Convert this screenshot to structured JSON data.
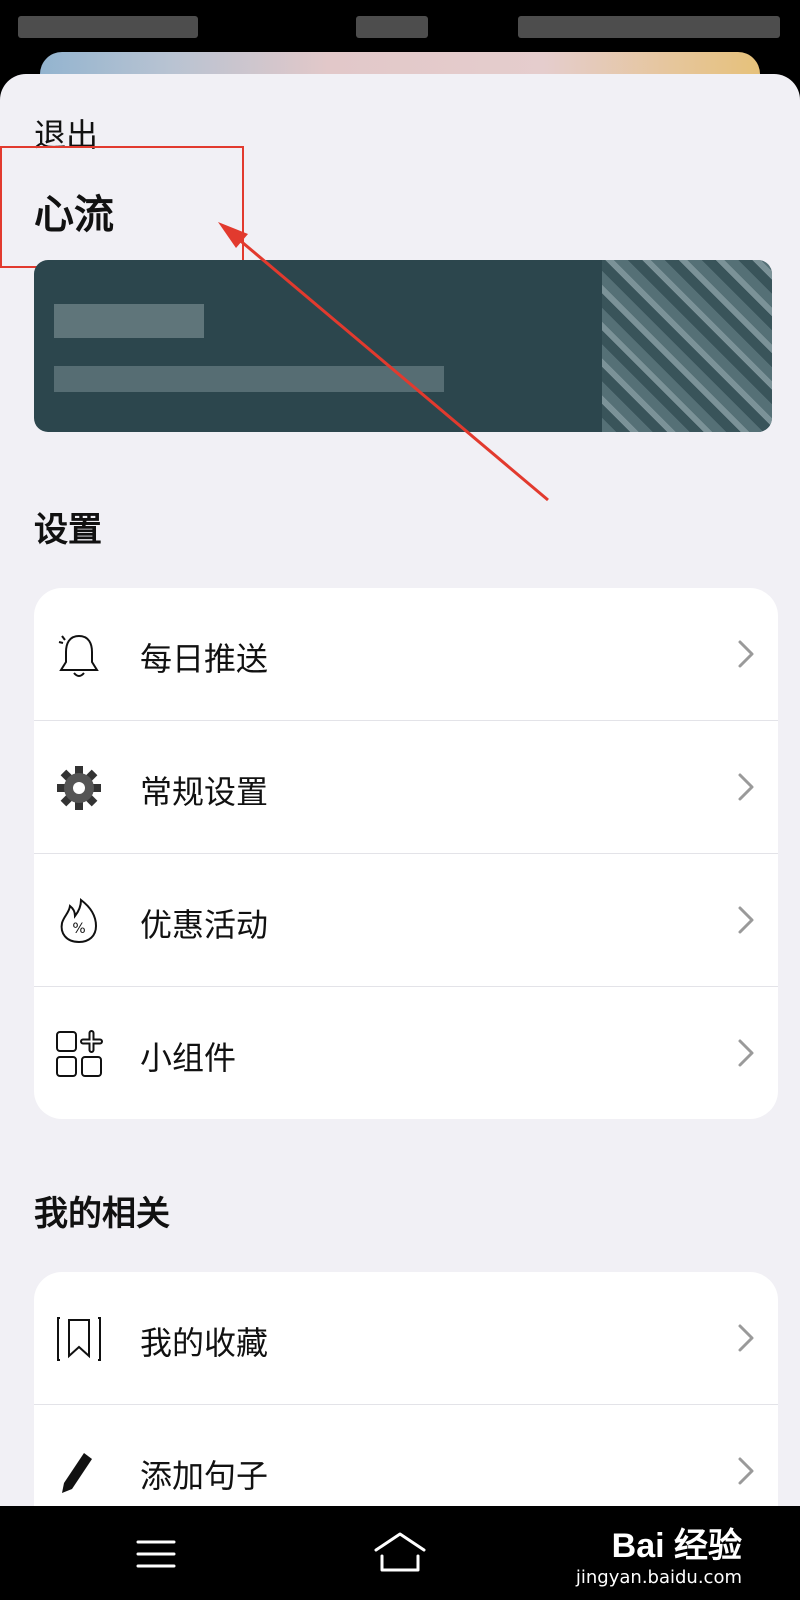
{
  "header": {
    "logout_label": "退出",
    "app_name": "心流"
  },
  "settings": {
    "title": "设置",
    "items": [
      {
        "label": "每日推送",
        "icon": "bell-icon"
      },
      {
        "label": "常规设置",
        "icon": "gear-icon"
      },
      {
        "label": "优惠活动",
        "icon": "discount-fire-icon"
      },
      {
        "label": "小组件",
        "icon": "widgets-icon"
      }
    ]
  },
  "related": {
    "title": "我的相关",
    "items": [
      {
        "label": "我的收藏",
        "icon": "bookmark-icon"
      },
      {
        "label": "添加句子",
        "icon": "pen-icon"
      }
    ]
  },
  "watermark": {
    "brand": "Bai 经验",
    "url": "jingyan.baidu.com"
  },
  "colors": {
    "sheet_bg": "#f1f0f5",
    "banner_bg": "#2c464d",
    "annotation": "#e23a2e"
  }
}
